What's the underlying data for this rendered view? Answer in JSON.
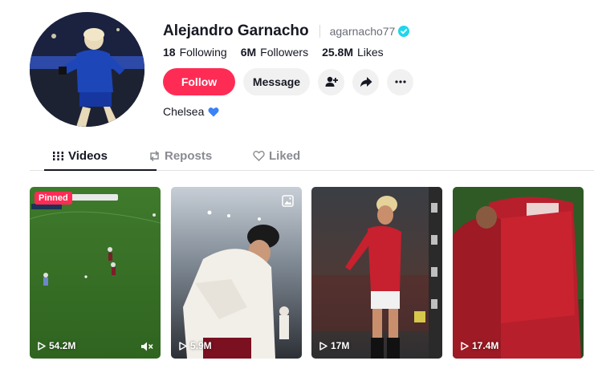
{
  "profile": {
    "display_name": "Alejandro Garnacho",
    "username": "agarnacho77",
    "verified": true,
    "bio": "Chelsea",
    "bio_emoji": "blue-heart-icon",
    "stats": [
      {
        "value": "18",
        "label": "Following"
      },
      {
        "value": "6M",
        "label": "Followers"
      },
      {
        "value": "25.8M",
        "label": "Likes"
      }
    ]
  },
  "actions": {
    "follow_label": "Follow",
    "message_label": "Message",
    "icons": [
      "add-user-icon",
      "share-icon",
      "more-icon"
    ]
  },
  "tabs": [
    {
      "label": "Videos",
      "icon": "grid-icon",
      "active": true
    },
    {
      "label": "Reposts",
      "icon": "repost-icon",
      "active": false
    },
    {
      "label": "Liked",
      "icon": "liked-heart-icon",
      "active": false
    }
  ],
  "videos": [
    {
      "views": "54.2M",
      "pinned_label": "Pinned",
      "muted": true
    },
    {
      "views": "5.9M",
      "photo": true
    },
    {
      "views": "17M"
    },
    {
      "views": "17.4M"
    }
  ],
  "colors": {
    "accent": "#fe2c55",
    "verified": "#20d5ec",
    "text": "#161823",
    "muted_text": "#8a8b91"
  }
}
